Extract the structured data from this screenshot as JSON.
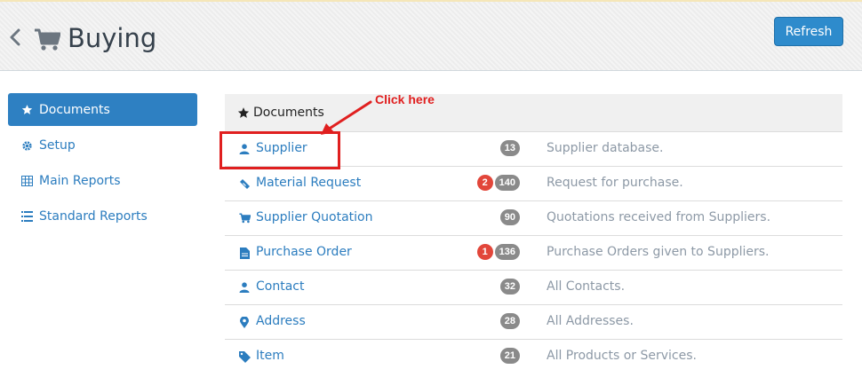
{
  "header": {
    "title": "Buying",
    "refresh_label": "Refresh",
    "icons": {
      "back": "chevron-left-icon",
      "module": "shopping-cart-icon"
    }
  },
  "sidebar": {
    "items": [
      {
        "label": "Documents",
        "icon": "star-icon",
        "active": true
      },
      {
        "label": "Setup",
        "icon": "gear-icon",
        "active": false
      },
      {
        "label": "Main Reports",
        "icon": "table-icon",
        "active": false
      },
      {
        "label": "Standard Reports",
        "icon": "list-icon",
        "active": false
      }
    ]
  },
  "panel": {
    "heading": "Documents",
    "heading_icon": "star-icon",
    "rows": [
      {
        "label": "Supplier",
        "icon": "user-icon",
        "new_count": null,
        "count": "13",
        "description": "Supplier database."
      },
      {
        "label": "Material Request",
        "icon": "ticket-icon",
        "new_count": "2",
        "count": "140",
        "description": "Request for purchase."
      },
      {
        "label": "Supplier Quotation",
        "icon": "shopping-cart-icon",
        "new_count": null,
        "count": "90",
        "description": "Quotations received from Suppliers."
      },
      {
        "label": "Purchase Order",
        "icon": "file-icon",
        "new_count": "1",
        "count": "136",
        "description": "Purchase Orders given to Suppliers."
      },
      {
        "label": "Contact",
        "icon": "user-icon",
        "new_count": null,
        "count": "32",
        "description": "All Contacts."
      },
      {
        "label": "Address",
        "icon": "map-marker-icon",
        "new_count": null,
        "count": "28",
        "description": "All Addresses."
      },
      {
        "label": "Item",
        "icon": "tag-icon",
        "new_count": null,
        "count": "21",
        "description": "All Products or Services."
      }
    ]
  },
  "annotation": {
    "callout": "Click here",
    "color": "#e01f1f"
  },
  "colors": {
    "accent": "#2e80c2",
    "link": "#2c7dbf",
    "badge_grey": "#8a8a8a",
    "badge_red": "#e2463a",
    "muted": "#8d99a6"
  }
}
